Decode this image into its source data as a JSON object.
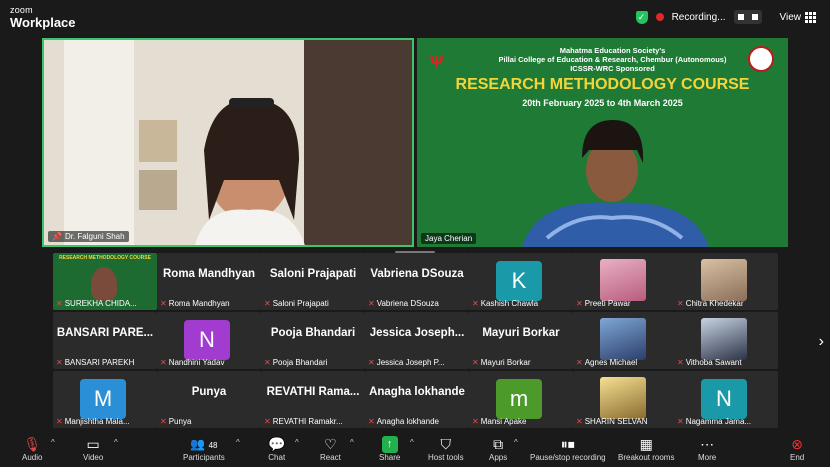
{
  "app": {
    "logo_line1": "zoom",
    "logo_line2": "Workplace"
  },
  "status": {
    "recording": "Recording...",
    "view": "View"
  },
  "speakers": [
    {
      "name": "Dr. Falguni Shah"
    },
    {
      "name": "Jaya Cherian"
    }
  ],
  "banner": {
    "line1": "Mahatma Education Society's",
    "line2": "Pillai College of Education & Research, Chembur (Autonomous)",
    "line3": "ICSSR-WRC Sponsored",
    "title": "RESEARCH METHODOLOGY COURSE",
    "dates": "20th February 2025 to 4th March 2025"
  },
  "gallery": {
    "row1": [
      {
        "display": "",
        "label": "SUREKHA CHIDA..."
      },
      {
        "display": "Roma Mandhyan",
        "label": "Roma Mandhyan"
      },
      {
        "display": "Saloni Prajapati",
        "label": "Saloni Prajapati"
      },
      {
        "display": "Vabriena DSouza",
        "label": "Vabriena DSouza"
      },
      {
        "display": "K",
        "label": "Kashish Chawla"
      },
      {
        "display": "",
        "label": "Preeti Pawar"
      },
      {
        "display": "",
        "label": "Chitra Khedekar"
      }
    ],
    "row2": [
      {
        "display": "BANSARI PARE...",
        "label": "BANSARI PAREKH"
      },
      {
        "display": "N",
        "label": "Nandhini Yadav"
      },
      {
        "display": "Pooja Bhandari",
        "label": "Pooja Bhandari"
      },
      {
        "display": "Jessica Joseph...",
        "label": "Jessica Joseph P..."
      },
      {
        "display": "Mayuri Borkar",
        "label": "Mayuri Borkar"
      },
      {
        "display": "",
        "label": "Agnes Michael"
      },
      {
        "display": "",
        "label": "Vithoba Sawant"
      }
    ],
    "row3": [
      {
        "display": "M",
        "label": "Manjishtha Mala..."
      },
      {
        "display": "Punya",
        "label": "Punya"
      },
      {
        "display": "REVATHI Rama...",
        "label": "REVATHI Ramakr..."
      },
      {
        "display": "Anagha lokhande",
        "label": "Anagha lokhande"
      },
      {
        "display": "m",
        "label": "Mansi Apake"
      },
      {
        "display": "",
        "label": "SHARIN SELVAN"
      },
      {
        "display": "N",
        "label": "Nagamma Jama..."
      }
    ]
  },
  "toolbar": {
    "audio": "Audio",
    "video": "Video",
    "participants": "Participants",
    "participants_count": "48",
    "chat": "Chat",
    "react": "React",
    "share": "Share",
    "host_tools": "Host tools",
    "apps": "Apps",
    "pause_rec": "Pause/stop recording",
    "breakout": "Breakout rooms",
    "more": "More",
    "end": "End"
  },
  "colors": {
    "active_speaker_border": "#3ec46d",
    "avatar_teal": "#1a9aa8",
    "avatar_purple": "#a23bd0",
    "avatar_blue": "#2b8fd8",
    "avatar_green": "#4c9a2a",
    "end_red": "#e33333"
  }
}
